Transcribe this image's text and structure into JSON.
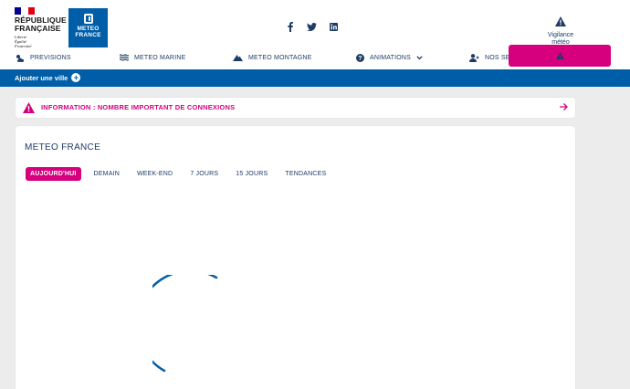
{
  "header": {
    "republique": {
      "line1": "RÉPUBLIQUE",
      "line2": "FRANÇAISE",
      "motto1": "Liberté",
      "motto2": "Égalité",
      "motto3": "Fraternité"
    },
    "meteo_logo": {
      "line1": "METEO",
      "line2": "FRANCE"
    },
    "social": [
      "facebook",
      "twitter",
      "linkedin"
    ],
    "vigilance": {
      "line1": "Vigilance",
      "line2": "météo"
    }
  },
  "nav": {
    "previsions": "PREVISIONS",
    "marine": "METEO MARINE",
    "montagne": "METEO MONTAGNE",
    "animations": "ANIMATIONS",
    "services": "NOS SER"
  },
  "cities_bar": {
    "add_city": "Ajouter une ville"
  },
  "info_banner": {
    "text": "INFORMATION : NOMBRE IMPORTANT DE CONNEXIONS"
  },
  "main": {
    "title": "METEO FRANCE",
    "tabs": [
      "AUJOURD'HUI",
      "DEMAIN",
      "WEEK-END",
      "7 JOURS",
      "15 JOURS",
      "TENDANCES"
    ],
    "active_tab": "AUJOURD'HUI"
  },
  "colors": {
    "brand_blue": "#005ea8",
    "navy": "#1d3b66",
    "magenta": "#d6007e",
    "background": "#ececec"
  }
}
